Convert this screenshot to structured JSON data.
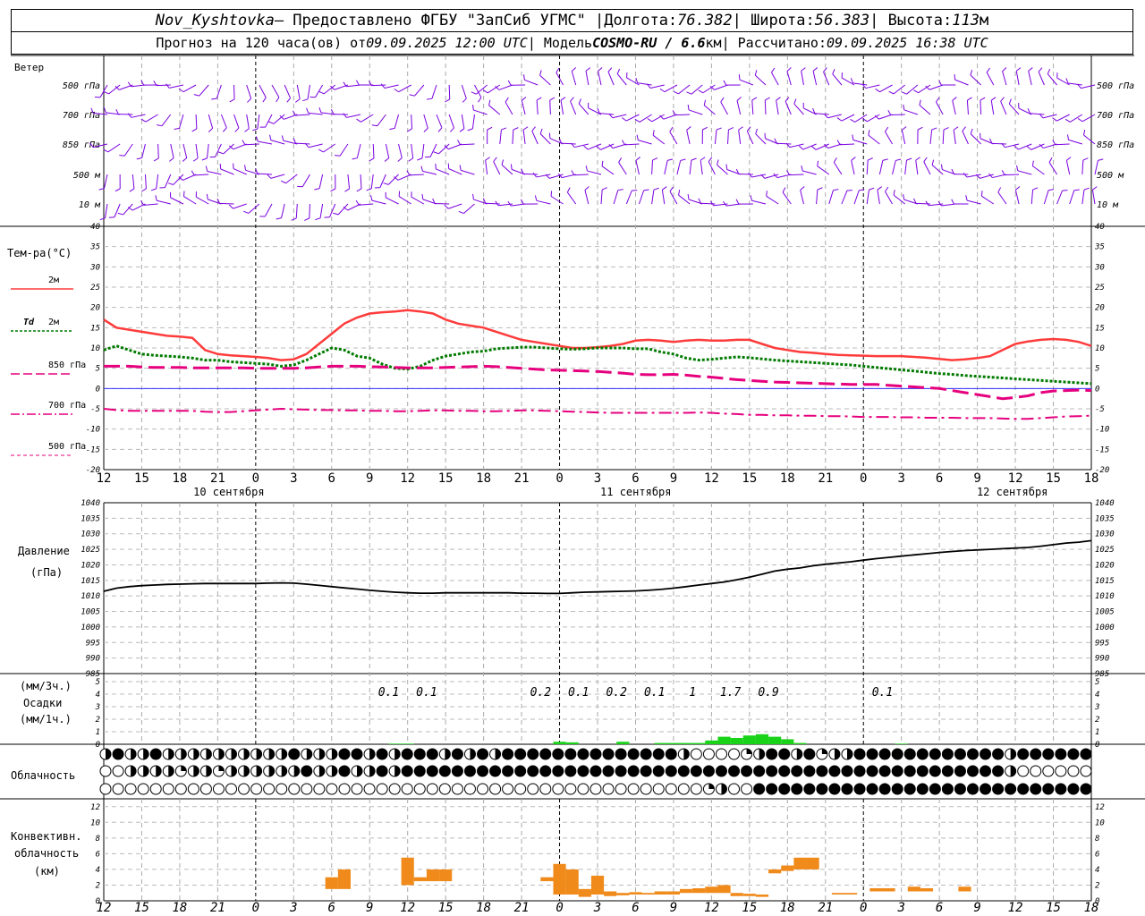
{
  "header": {
    "station": "Nov_Kyshtovka",
    "provider": " — Предоставлено ФГБУ \"ЗапСиб УГМС\" | ",
    "lon_label": "Долгота: ",
    "lon_value": "76.382",
    "lat_label": " | Широта: ",
    "lat_value": "56.383",
    "alt_label": " | Высота: ",
    "alt_value": "113",
    "alt_unit": "м",
    "forecast_prefix": "Прогноз на 120 часа(ов) от ",
    "forecast_start": "09.09.2025 12:00 UTC",
    "model_label": " | Модель ",
    "model_name": "COSMO-RU / 6.6",
    "model_unit": "км",
    "calc_label": " | Рассчитано: ",
    "calc_time": "09.09.2025 16:38 UTC"
  },
  "colors": {
    "t2m": "#ff3b3b",
    "td2m": "#007a00",
    "t850": "#e6007e",
    "t700": "#e6007e",
    "t500": "#e6007e",
    "wind": "#7a00e0",
    "pressure": "#000000",
    "precip": "#19d319",
    "convective": "#f08a1a",
    "zero_line": "#3030ff"
  },
  "chart_data": [
    {
      "id": "wind",
      "type": "wind_barbs",
      "title": "Ветер",
      "levels": [
        "500 гПа",
        "700 гПа",
        "850 гПа",
        "500 м",
        "10 м"
      ]
    },
    {
      "id": "temperature",
      "type": "line",
      "title": "Тем-ра(°C)",
      "ylim": [
        -20,
        40
      ],
      "yticks": [
        40,
        35,
        30,
        25,
        20,
        15,
        10,
        5,
        0,
        -5,
        -10,
        -15,
        -20
      ],
      "legend": [
        {
          "name": "2м",
          "label2": "",
          "style": "solid"
        },
        {
          "name": "2м",
          "label1": "Td",
          "style": "dotted"
        },
        {
          "name": "850 гПа",
          "style": "dashed"
        },
        {
          "name": "700 гПа",
          "style": "dashdot"
        },
        {
          "name": "500 гПа",
          "style": "dashed-thin"
        }
      ],
      "x": [
        0,
        1,
        2,
        3,
        4,
        5,
        6,
        7,
        8,
        9,
        10,
        11,
        12,
        13,
        14,
        15,
        16,
        17,
        18,
        19,
        20,
        21,
        22,
        23,
        24,
        25,
        26,
        27,
        28,
        29,
        30,
        31,
        32,
        33,
        34,
        35,
        36,
        37,
        38,
        39,
        40,
        41,
        42,
        43,
        44,
        45,
        46,
        47,
        48,
        49,
        50,
        51,
        52,
        53,
        54,
        55,
        56,
        57,
        58,
        59,
        60,
        61,
        62,
        63,
        64,
        65,
        66,
        67,
        68,
        69,
        70,
        71,
        72,
        73,
        74,
        75,
        76,
        77,
        78
      ],
      "series": [
        {
          "key": "t2m",
          "values": [
            17,
            15,
            14.5,
            14,
            13.5,
            13,
            12.8,
            12.5,
            9.5,
            8.5,
            8.2,
            8,
            7.8,
            7.5,
            7,
            7.2,
            8.5,
            11,
            13.5,
            16,
            17.5,
            18.5,
            18.8,
            19,
            19.3,
            19,
            18.5,
            17,
            16,
            15.5,
            15,
            14,
            13,
            12,
            11.5,
            11,
            10.5,
            10,
            10,
            10.2,
            10.5,
            11,
            11.8,
            12,
            11.8,
            11.5,
            11.8,
            12,
            11.8,
            11.8,
            12,
            12,
            11,
            10,
            9.5,
            9,
            8.8,
            8.5,
            8.3,
            8.2,
            8.1,
            8,
            8,
            8,
            7.8,
            7.6,
            7.3,
            7,
            7.2,
            7.5,
            8,
            9.5,
            11,
            11.6,
            12,
            12.2,
            12,
            11.5,
            10.5
          ]
        },
        {
          "key": "td2m",
          "values": [
            9.5,
            10.5,
            9.5,
            8.5,
            8.2,
            8,
            7.8,
            7.5,
            7,
            7,
            6.6,
            6.4,
            6.2,
            6,
            5.5,
            5.8,
            7,
            8.5,
            10,
            9.5,
            8,
            7.5,
            6,
            5,
            4.8,
            5.5,
            7,
            8,
            8.5,
            9,
            9.2,
            9.8,
            10,
            10.2,
            10.2,
            10,
            9.8,
            9.7,
            9.8,
            10,
            10,
            10,
            9.8,
            9.8,
            9,
            8.5,
            7.5,
            7,
            7.2,
            7.5,
            7.8,
            7.6,
            7.3,
            7,
            6.8,
            6.6,
            6.4,
            6.2,
            6,
            5.8,
            5.5,
            5.2,
            4.9,
            4.6,
            4.3,
            4,
            3.7,
            3.5,
            3.2,
            3,
            2.8,
            2.6,
            2.4,
            2.2,
            2,
            1.8,
            1.6,
            1.4,
            1.2
          ]
        },
        {
          "key": "t850",
          "values": [
            5.5,
            5.5,
            5.5,
            5.3,
            5.2,
            5.2,
            5.2,
            5.1,
            5.1,
            5.1,
            5.1,
            5.1,
            5,
            5,
            5,
            5,
            5.1,
            5.3,
            5.5,
            5.5,
            5.5,
            5.4,
            5.3,
            5.2,
            5.1,
            5.1,
            5.1,
            5.2,
            5.3,
            5.4,
            5.5,
            5.4,
            5.2,
            5,
            4.8,
            4.6,
            4.5,
            4.4,
            4.3,
            4.2,
            4,
            3.8,
            3.5,
            3.4,
            3.4,
            3.5,
            3.3,
            3,
            2.8,
            2.5,
            2.2,
            2,
            1.8,
            1.6,
            1.5,
            1.4,
            1.3,
            1.2,
            1.1,
            1,
            1,
            1,
            0.8,
            0.6,
            0.4,
            0.2,
            0,
            -0.5,
            -1,
            -1.5,
            -2,
            -2.5,
            -2.2,
            -1.8,
            -1,
            -0.6,
            -0.5,
            -0.4,
            -0.5
          ]
        },
        {
          "key": "t700",
          "values": [
            -5,
            -5.3,
            -5.5,
            -5.5,
            -5.5,
            -5.5,
            -5.5,
            -5.5,
            -5.7,
            -5.8,
            -5.8,
            -5.6,
            -5.4,
            -5.2,
            -5,
            -5.1,
            -5.2,
            -5.3,
            -5.3,
            -5.4,
            -5.4,
            -5.5,
            -5.5,
            -5.6,
            -5.6,
            -5.5,
            -5.4,
            -5.4,
            -5.5,
            -5.5,
            -5.6,
            -5.6,
            -5.5,
            -5.4,
            -5.4,
            -5.5,
            -5.6,
            -5.7,
            -5.8,
            -5.9,
            -6,
            -6,
            -6,
            -6,
            -6,
            -6,
            -6,
            -5.9,
            -6,
            -6.2,
            -6.3,
            -6.5,
            -6.5,
            -6.6,
            -6.6,
            -6.7,
            -6.7,
            -6.8,
            -6.8,
            -6.9,
            -7,
            -7,
            -7,
            -7.1,
            -7.1,
            -7.2,
            -7.2,
            -7.2,
            -7.3,
            -7.3,
            -7.3,
            -7.4,
            -7.5,
            -7.5,
            -7.3,
            -7.1,
            -6.9,
            -6.8,
            -6.7
          ]
        }
      ],
      "x_ticks": [
        "12",
        "15",
        "18",
        "21",
        "0",
        "3",
        "6",
        "9",
        "12",
        "15",
        "18",
        "21",
        "0",
        "3",
        "6",
        "9",
        "12",
        "15",
        "18",
        "21",
        "0",
        "3",
        "6",
        "9",
        "12",
        "15",
        "18"
      ],
      "day_labels": [
        "10 сентября",
        "11 сентября",
        "12 сентября"
      ]
    },
    {
      "id": "pressure",
      "type": "line",
      "title": "Давление",
      "unit_label": "(гПа)",
      "ylim": [
        985,
        1040
      ],
      "yticks": [
        1040,
        1035,
        1030,
        1025,
        1020,
        1015,
        1010,
        1005,
        1000,
        995,
        990,
        985
      ],
      "values": [
        1011.5,
        1012.5,
        1013,
        1013.3,
        1013.5,
        1013.7,
        1013.8,
        1013.9,
        1014,
        1014,
        1014,
        1014,
        1014,
        1014.1,
        1014.2,
        1014.1,
        1013.8,
        1013.4,
        1013,
        1012.6,
        1012.2,
        1011.8,
        1011.5,
        1011.2,
        1011,
        1010.9,
        1010.9,
        1011,
        1011,
        1011,
        1011,
        1011,
        1011,
        1010.9,
        1010.9,
        1010.8,
        1010.8,
        1011,
        1011.2,
        1011.3,
        1011.4,
        1011.5,
        1011.6,
        1011.8,
        1012.1,
        1012.5,
        1013,
        1013.5,
        1014,
        1014.5,
        1015.2,
        1016,
        1017,
        1018,
        1018.6,
        1019,
        1019.7,
        1020.2,
        1020.6,
        1021,
        1021.5,
        1022,
        1022.4,
        1022.8,
        1023.2,
        1023.6,
        1024,
        1024.3,
        1024.6,
        1024.8,
        1025,
        1025.2,
        1025.4,
        1025.6,
        1026,
        1026.5,
        1027,
        1027.3,
        1027.8
      ]
    },
    {
      "id": "precip",
      "type": "bar",
      "title_unit3": "(мм/3ч.)",
      "title": "Осадки",
      "title_unit1": "(мм/1ч.)",
      "ylim": [
        0,
        5
      ],
      "yticks": [
        5,
        4,
        3,
        2,
        1,
        0
      ],
      "hourly": [
        {
          "x": 23,
          "v": 0.05
        },
        {
          "x": 24,
          "v": 0.05
        },
        {
          "x": 36,
          "v": 0.2
        },
        {
          "x": 37,
          "v": 0.15
        },
        {
          "x": 41,
          "v": 0.2
        },
        {
          "x": 44,
          "v": 0.1
        },
        {
          "x": 45,
          "v": 0.1
        },
        {
          "x": 46,
          "v": 0.1
        },
        {
          "x": 47,
          "v": 0.1
        },
        {
          "x": 48,
          "v": 0.3
        },
        {
          "x": 49,
          "v": 0.6
        },
        {
          "x": 50,
          "v": 0.5
        },
        {
          "x": 51,
          "v": 0.7
        },
        {
          "x": 52,
          "v": 0.8
        },
        {
          "x": 53,
          "v": 0.6
        },
        {
          "x": 54,
          "v": 0.4
        },
        {
          "x": 55,
          "v": 0.1
        },
        {
          "x": 63,
          "v": 0.05
        }
      ],
      "sums": [
        {
          "x": 22.5,
          "label": "0.1"
        },
        {
          "x": 25.5,
          "label": "0.1"
        },
        {
          "x": 34.5,
          "label": "0.2"
        },
        {
          "x": 37.5,
          "label": "0.1"
        },
        {
          "x": 40.5,
          "label": "0.2"
        },
        {
          "x": 43.5,
          "label": "0.1"
        },
        {
          "x": 46.5,
          "label": "1"
        },
        {
          "x": 49.5,
          "label": "1.7"
        },
        {
          "x": 52.5,
          "label": "0.9"
        },
        {
          "x": 61.5,
          "label": "0.1"
        }
      ]
    },
    {
      "id": "cloud",
      "type": "symbols",
      "title": "Облачность",
      "rows": [
        "34334333333333343334434344434343444444444444443000023443423344444444444434444443334444000000000000000000000000000000000000000000000000003000",
        "00333323323333334334334344444444444444444444444444444444444444444444444430000000000000000000000000000000000000000000000000000000000000000000",
        "00000000000000000000000000000000000000000000000023004444444444444444444444444444444444444444444444444444444444444300000000000000000300003"
      ]
    },
    {
      "id": "convective",
      "type": "bar",
      "title": "Конвективн.",
      "title2": "облачность",
      "unit_label": "(км)",
      "ylim": [
        0,
        13
      ],
      "yticks": [
        12,
        10,
        8,
        6,
        4,
        2,
        0
      ],
      "bars": [
        {
          "x": 18,
          "b": 1.5,
          "t": 3
        },
        {
          "x": 19,
          "b": 1.5,
          "t": 4
        },
        {
          "x": 24,
          "b": 2,
          "t": 5.5
        },
        {
          "x": 25,
          "b": 2.5,
          "t": 3
        },
        {
          "x": 26,
          "b": 2.5,
          "t": 4
        },
        {
          "x": 27,
          "b": 2.5,
          "t": 4
        },
        {
          "x": 35,
          "b": 2.5,
          "t": 3
        },
        {
          "x": 36,
          "b": 0.8,
          "t": 4.7
        },
        {
          "x": 37,
          "b": 0.8,
          "t": 4
        },
        {
          "x": 38,
          "b": 0.5,
          "t": 1.5
        },
        {
          "x": 39,
          "b": 0.8,
          "t": 3.2
        },
        {
          "x": 40,
          "b": 0.6,
          "t": 1.2
        },
        {
          "x": 41,
          "b": 0.7,
          "t": 1
        },
        {
          "x": 42,
          "b": 0.8,
          "t": 1.1
        },
        {
          "x": 43,
          "b": 0.8,
          "t": 1
        },
        {
          "x": 44,
          "b": 0.8,
          "t": 1.2
        },
        {
          "x": 45,
          "b": 0.8,
          "t": 1.2
        },
        {
          "x": 46,
          "b": 1,
          "t": 1.5
        },
        {
          "x": 47,
          "b": 1,
          "t": 1.6
        },
        {
          "x": 48,
          "b": 1,
          "t": 1.8
        },
        {
          "x": 49,
          "b": 1,
          "t": 2
        },
        {
          "x": 50,
          "b": 0.6,
          "t": 1
        },
        {
          "x": 51,
          "b": 0.6,
          "t": 0.9
        },
        {
          "x": 52,
          "b": 0.5,
          "t": 0.8
        },
        {
          "x": 53,
          "b": 3.5,
          "t": 4
        },
        {
          "x": 54,
          "b": 3.8,
          "t": 4.5
        },
        {
          "x": 55,
          "b": 4,
          "t": 5.5
        },
        {
          "x": 56,
          "b": 4,
          "t": 5.5
        },
        {
          "x": 58,
          "b": 0.8,
          "t": 1
        },
        {
          "x": 59,
          "b": 0.8,
          "t": 1
        },
        {
          "x": 61,
          "b": 1.2,
          "t": 1.6
        },
        {
          "x": 62,
          "b": 1.2,
          "t": 1.6
        },
        {
          "x": 64,
          "b": 1.2,
          "t": 1.8
        },
        {
          "x": 65,
          "b": 1.2,
          "t": 1.6
        },
        {
          "x": 68,
          "b": 1.2,
          "t": 1.8
        }
      ]
    }
  ]
}
